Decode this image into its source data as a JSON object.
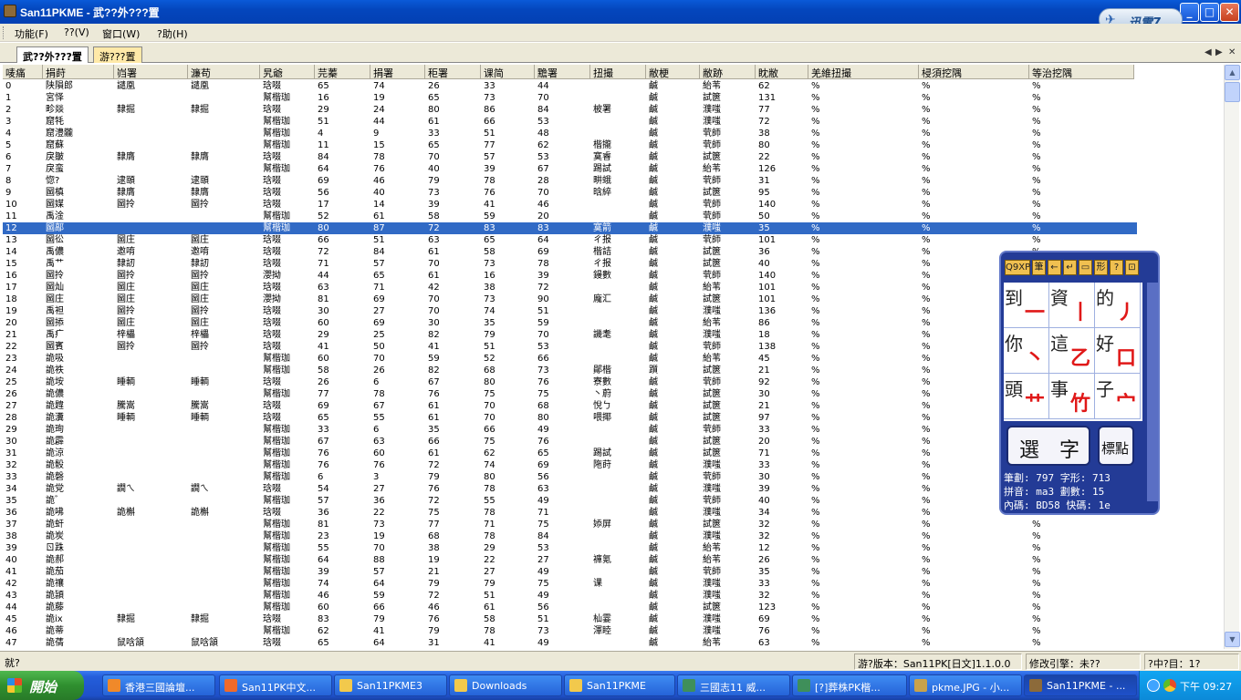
{
  "window": {
    "title": "San11PKME - 武??外???置",
    "min": "_",
    "max": "□",
    "close": "✕"
  },
  "xunlei": {
    "label": "迅雷7"
  },
  "menu": [
    "功能(F)",
    "??(V)",
    "窗口(W)",
    "?助(H)"
  ],
  "tabs": [
    "武??外???置",
    "游???置"
  ],
  "columns": [
    "唛痛",
    "捐莳",
    "岿署",
    "濂苟",
    "旯爺",
    "芫蓁",
    "捐署",
    "秬署",
    "课简",
    "黵署",
    "扭撮",
    "敝梗",
    "敝跡",
    "眈敝",
    "羌維扭撮",
    "梫須挖隅",
    "等治挖隅"
  ],
  "rows": [
    [
      "0",
      "陕隕郎",
      "譴凰",
      "譴凰",
      "琀啜",
      "65",
      "74",
      "26",
      "33",
      "44",
      "",
      "鹹",
      "紿苇",
      "62",
      "%",
      "%",
      "%"
    ],
    [
      "1",
      "宮怿",
      "",
      "",
      "幫楷珈",
      "16",
      "19",
      "65",
      "73",
      "70",
      "",
      "鹹",
      "試篋",
      "131",
      "%",
      "%",
      "%"
    ],
    [
      "2",
      "畛燚",
      "隸掘",
      "隸掘",
      "琀啜",
      "29",
      "24",
      "80",
      "86",
      "84",
      "柀署",
      "鹹",
      "濮嗤",
      "77",
      "%",
      "%",
      "%"
    ],
    [
      "3",
      "窟牦",
      "",
      "",
      "幫楷珈",
      "51",
      "44",
      "61",
      "66",
      "53",
      "",
      "鹹",
      "濮嗤",
      "72",
      "%",
      "%",
      "%"
    ],
    [
      "4",
      "窟澧龖",
      "",
      "",
      "幫楷珈",
      "4",
      "9",
      "33",
      "51",
      "48",
      "",
      "鹹",
      "茕師",
      "38",
      "%",
      "%",
      "%"
    ],
    [
      "5",
      "窟蘇",
      "",
      "",
      "幫楷珈",
      "11",
      "15",
      "65",
      "77",
      "62",
      "楷攏",
      "鹹",
      "茕師",
      "80",
      "%",
      "%",
      "%"
    ],
    [
      "6",
      "戾皺",
      "隸膺",
      "隸膺",
      "琀啜",
      "84",
      "78",
      "70",
      "57",
      "53",
      "寞睿",
      "鹹",
      "試篋",
      "22",
      "%",
      "%",
      "%"
    ],
    [
      "7",
      "戾蛮",
      "",
      "",
      "幫楷珈",
      "64",
      "76",
      "40",
      "39",
      "67",
      "踢試",
      "鹹",
      "紿苇",
      "126",
      "%",
      "%",
      "%"
    ],
    [
      "8",
      "惚?",
      "逮頤",
      "逮頤",
      "琀啜",
      "69",
      "46",
      "79",
      "78",
      "28",
      "畊蛾",
      "鹹",
      "茕師",
      "31",
      "%",
      "%",
      "%"
    ],
    [
      "9",
      "圙槙",
      "隸膺",
      "隸膺",
      "琀啜",
      "56",
      "40",
      "73",
      "76",
      "70",
      "晗綷",
      "鹹",
      "試篋",
      "95",
      "%",
      "%",
      "%"
    ],
    [
      "10",
      "圙媒",
      "圙拎",
      "圙拎",
      "琀啜",
      "17",
      "14",
      "39",
      "41",
      "46",
      "",
      "鹹",
      "茕師",
      "140",
      "%",
      "%",
      "%"
    ],
    [
      "11",
      "禹淦",
      "",
      "",
      "幫楷珈",
      "52",
      "61",
      "58",
      "59",
      "20",
      "",
      "鹹",
      "茕師",
      "50",
      "%",
      "%",
      "%"
    ],
    [
      "12",
      "圙鄗",
      "",
      "",
      "幫楷珈",
      "80",
      "87",
      "72",
      "83",
      "83",
      "寞箭",
      "鹹",
      "濮嗤",
      "35",
      "%",
      "%",
      "%"
    ],
    [
      "13",
      "圙彸",
      "圙庄",
      "圙庄",
      "琀啜",
      "66",
      "51",
      "63",
      "65",
      "64",
      "ㄔ报",
      "鹹",
      "茕師",
      "101",
      "%",
      "%",
      "%"
    ],
    [
      "14",
      "禹儂",
      "邀唷",
      "邀唷",
      "琀啜",
      "72",
      "84",
      "61",
      "58",
      "69",
      "楷詰",
      "鹹",
      "試篋",
      "36",
      "%",
      "%",
      "%"
    ],
    [
      "15",
      "禹艹",
      "隸訒",
      "隸訒",
      "琀啜",
      "71",
      "57",
      "70",
      "73",
      "78",
      "ㄔ报",
      "鹹",
      "試篋",
      "40",
      "%",
      "%",
      "%"
    ],
    [
      "16",
      "圙拎",
      "圙拎",
      "圙拎",
      "瀴拗",
      "44",
      "65",
      "61",
      "16",
      "39",
      "鏝數",
      "鹹",
      "茕師",
      "140",
      "%",
      "%",
      "%"
    ],
    [
      "17",
      "圙灿",
      "圙庄",
      "圙庄",
      "琀啜",
      "63",
      "71",
      "42",
      "38",
      "72",
      "",
      "鹹",
      "紿苇",
      "101",
      "%",
      "%",
      "%"
    ],
    [
      "18",
      "圙庄",
      "圙庄",
      "圙庄",
      "瀴拗",
      "81",
      "69",
      "70",
      "73",
      "90",
      "龐汇",
      "鹹",
      "試篋",
      "101",
      "%",
      "%",
      "%"
    ],
    [
      "19",
      "禹袒",
      "圙拎",
      "圙拎",
      "琀啜",
      "30",
      "27",
      "70",
      "74",
      "51",
      "",
      "鹹",
      "濮嗤",
      "136",
      "%",
      "%",
      "%"
    ],
    [
      "20",
      "圙掭",
      "圙庄",
      "圙庄",
      "琀啜",
      "60",
      "69",
      "30",
      "35",
      "59",
      "",
      "鹹",
      "紿苇",
      "86",
      "%",
      "%",
      "%"
    ],
    [
      "21",
      "禹疒",
      "梓櫑",
      "梓櫑",
      "琀啜",
      "29",
      "25",
      "82",
      "79",
      "70",
      "譏耄",
      "鹹",
      "濮嗤",
      "18",
      "%",
      "%",
      "%"
    ],
    [
      "22",
      "圙賓",
      "圙拎",
      "圙拎",
      "琀啜",
      "41",
      "50",
      "41",
      "51",
      "53",
      "",
      "鹹",
      "茕師",
      "138",
      "%",
      "%",
      "%"
    ],
    [
      "23",
      "詭吸",
      "",
      "",
      "幫楷珈",
      "60",
      "70",
      "59",
      "52",
      "66",
      "",
      "鹹",
      "紿苇",
      "45",
      "%",
      "%",
      "%"
    ],
    [
      "24",
      "詭袟",
      "",
      "",
      "幫楷珈",
      "58",
      "26",
      "82",
      "68",
      "73",
      "鄖楷",
      "躓",
      "試篋",
      "21",
      "%",
      "%",
      "%"
    ],
    [
      "25",
      "詭垵",
      "睡輌",
      "睡輌",
      "琀啜",
      "26",
      "6",
      "67",
      "80",
      "76",
      "寮數",
      "鹹",
      "茕師",
      "92",
      "%",
      "%",
      "%"
    ],
    [
      "26",
      "詭儂",
      "",
      "",
      "幫楷珈",
      "77",
      "78",
      "76",
      "75",
      "75",
      "丶蔚",
      "鹹",
      "試篋",
      "30",
      "%",
      "%",
      "%"
    ],
    [
      "27",
      "詭韙",
      "騰嵩",
      "騰嵩",
      "琀啜",
      "69",
      "67",
      "61",
      "70",
      "68",
      "悅ㄅ",
      "鹹",
      "試篋",
      "21",
      "%",
      "%",
      "%"
    ],
    [
      "28",
      "詭瀵",
      "睡輌",
      "睡輌",
      "琀啜",
      "65",
      "55",
      "61",
      "70",
      "80",
      "喂揶",
      "鹹",
      "試篋",
      "97",
      "%",
      "%",
      "%"
    ],
    [
      "29",
      "詭珣",
      "",
      "",
      "幫楷珈",
      "33",
      "6",
      "35",
      "66",
      "49",
      "",
      "鹹",
      "茕師",
      "33",
      "%",
      "%",
      "%"
    ],
    [
      "30",
      "詭霹",
      "",
      "",
      "幫楷珈",
      "67",
      "63",
      "66",
      "75",
      "76",
      "",
      "鹹",
      "試篋",
      "20",
      "%",
      "%",
      "%"
    ],
    [
      "31",
      "詭涼",
      "",
      "",
      "幫楷珈",
      "76",
      "60",
      "61",
      "62",
      "65",
      "踢試",
      "鹹",
      "試篋",
      "71",
      "%",
      "%",
      "%"
    ],
    [
      "32",
      "詭骰",
      "",
      "",
      "幫楷珈",
      "76",
      "76",
      "72",
      "74",
      "69",
      "陁莳",
      "鹹",
      "濮嗤",
      "33",
      "%",
      "%",
      "%"
    ],
    [
      "33",
      "詭磬",
      "",
      "",
      "幫楷珈",
      "6",
      "3",
      "79",
      "80",
      "56",
      "",
      "鹹",
      "茕師",
      "30",
      "%",
      "%",
      "%"
    ],
    [
      "34",
      "詭党",
      "譋ㄟ",
      "譋ㄟ",
      "琀啜",
      "54",
      "27",
      "76",
      "78",
      "63",
      "",
      "鹹",
      "濮嗤",
      "39",
      "%",
      "%",
      "%"
    ],
    [
      "35",
      "詭゛",
      "",
      "",
      "幫楷珈",
      "57",
      "36",
      "72",
      "55",
      "49",
      "",
      "鹹",
      "茕師",
      "40",
      "%",
      "%",
      "%"
    ],
    [
      "36",
      "詭咈",
      "詭槲",
      "詭槲",
      "琀啜",
      "36",
      "22",
      "75",
      "78",
      "71",
      "",
      "鹹",
      "濮嗤",
      "34",
      "%",
      "%",
      "%"
    ],
    [
      "37",
      "詭虷",
      "",
      "",
      "幫楷珈",
      "81",
      "73",
      "77",
      "71",
      "75",
      "婖屏",
      "鹹",
      "試篋",
      "32",
      "%",
      "%",
      "%"
    ],
    [
      "38",
      "詭炭",
      "",
      "",
      "幫楷珈",
      "23",
      "19",
      "68",
      "78",
      "84",
      "",
      "鹹",
      "濮嗤",
      "32",
      "%",
      "%",
      "%"
    ],
    [
      "39",
      "ㄖ跦",
      "",
      "",
      "幫楷珈",
      "55",
      "70",
      "38",
      "29",
      "53",
      "",
      "鹹",
      "紿苇",
      "12",
      "%",
      "%",
      "%"
    ],
    [
      "40",
      "詭郝",
      "",
      "",
      "幫楷珈",
      "64",
      "88",
      "19",
      "22",
      "27",
      "褲氪",
      "鹹",
      "紿苇",
      "26",
      "%",
      "%",
      "%"
    ],
    [
      "41",
      "詭茄",
      "",
      "",
      "幫楷珈",
      "39",
      "57",
      "21",
      "27",
      "49",
      "",
      "鹹",
      "茕師",
      "35",
      "%",
      "%",
      "%"
    ],
    [
      "42",
      "詭禳",
      "",
      "",
      "幫楷珈",
      "74",
      "64",
      "79",
      "79",
      "75",
      "课",
      "鹹",
      "濮嗤",
      "33",
      "%",
      "%",
      "%"
    ],
    [
      "43",
      "詭頴",
      "",
      "",
      "幫楷珈",
      "46",
      "59",
      "72",
      "51",
      "49",
      "",
      "鹹",
      "濮嗤",
      "32",
      "%",
      "%",
      "%"
    ],
    [
      "44",
      "詭藤",
      "",
      "",
      "幫楷珈",
      "60",
      "66",
      "46",
      "61",
      "56",
      "",
      "鹹",
      "試篋",
      "123",
      "%",
      "%",
      "%"
    ],
    [
      "45",
      "詭ix",
      "隸掘",
      "隸掘",
      "琀啜",
      "83",
      "79",
      "76",
      "58",
      "51",
      "杣霎",
      "鹹",
      "濮嗤",
      "69",
      "%",
      "%",
      "%"
    ],
    [
      "46",
      "詭蒂",
      "",
      "",
      "幫楷珈",
      "62",
      "41",
      "79",
      "78",
      "73",
      "渾睦",
      "鹹",
      "濮嗤",
      "76",
      "%",
      "%",
      "%"
    ],
    [
      "47",
      "詭蒨",
      "鼠唅頷",
      "鼠唅頷",
      "琀啜",
      "65",
      "64",
      "31",
      "41",
      "49",
      "",
      "鹹",
      "紿苇",
      "63",
      "%",
      "%",
      "%"
    ]
  ],
  "selected_row": 12,
  "status": {
    "left": "就?",
    "version": "游?版本：San11PK[日文]1.1.0.0",
    "engine": "修改引擎：未??",
    "position": "?中?目：1?"
  },
  "taskbar": {
    "start": "開始",
    "items": [
      "香港三國論壇...",
      "San11PK中文...",
      "San11PKME3",
      "Downloads",
      "San11PKME",
      "三國志11 威...",
      "[?]葬株PK楷...",
      "pkme.JPG - 小...",
      "San11PKME - ..."
    ],
    "clock": "下午 09:27"
  },
  "ime": {
    "tools": [
      "Q9XP",
      "筆",
      "←",
      "↵",
      "▭",
      "形",
      "?",
      "⊡"
    ],
    "cells": [
      {
        "ch": "到",
        "st": "一"
      },
      {
        "ch": "資",
        "st": "丨"
      },
      {
        "ch": "的",
        "st": "丿"
      },
      {
        "ch": "你",
        "st": "丶"
      },
      {
        "ch": "這",
        "st": "乙"
      },
      {
        "ch": "好",
        "st": "口"
      },
      {
        "ch": "頭",
        "st": "艹"
      },
      {
        "ch": "事",
        "st": "竹"
      },
      {
        "ch": "子",
        "st": "宀"
      }
    ],
    "select_label": "選　字",
    "punct_label": "標點",
    "info": [
      "筆劃: 797 字形: 713",
      "拼音: ma3 劃數: 15",
      "內碼: BD58 快碼: 1e"
    ]
  },
  "colors": {
    "title": "#0a5ad8",
    "selection": "#316ac5",
    "taskbar": "#245edb",
    "start": "#2f8f2f",
    "ime": "#233b96"
  }
}
